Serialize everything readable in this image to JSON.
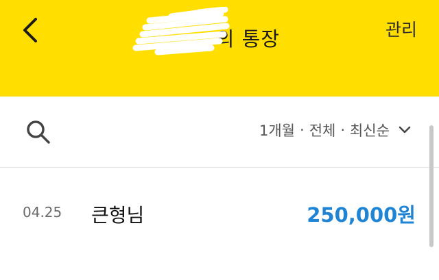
{
  "header": {
    "title": "의 통장",
    "manage_label": "관리",
    "background_color": "#ffde00"
  },
  "filter": {
    "period": "1개월",
    "type": "전체",
    "sort": "최신순",
    "separator": "·"
  },
  "transactions": [
    {
      "date": "04.25",
      "name": "큰형님",
      "amount": "250,000원",
      "amount_color": "#1f84d4"
    }
  ],
  "icons": {
    "back": "chevron-left-icon",
    "search": "search-icon",
    "dropdown": "chevron-down-icon"
  }
}
